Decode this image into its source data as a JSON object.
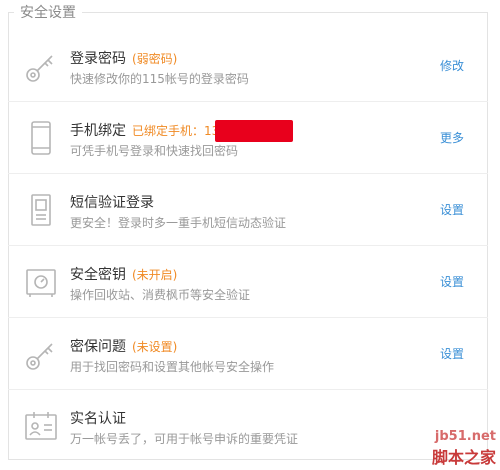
{
  "section_title": "安全设置",
  "items": [
    {
      "title": "登录密码",
      "status": "(弱密码)",
      "desc": "快速修改你的115帐号的登录密码",
      "action": "修改",
      "icon": "key-icon"
    },
    {
      "title": "手机绑定",
      "status": "已绑定手机：13",
      "desc": "可凭手机号登录和快速找回密码",
      "action": "更多",
      "icon": "phone-icon",
      "redacted": true
    },
    {
      "title": "短信验证登录",
      "status": "",
      "desc": "更安全！登录时多一重手机短信动态验证",
      "action": "设置",
      "icon": "sms-device-icon"
    },
    {
      "title": "安全密钥",
      "status": "(未开启)",
      "desc": "操作回收站、消费枫币等安全验证",
      "action": "设置",
      "icon": "safe-icon"
    },
    {
      "title": "密保问题",
      "status": "(未设置)",
      "desc": "用于找回密码和设置其他帐号安全操作",
      "action": "设置",
      "icon": "key-icon"
    },
    {
      "title": "实名认证",
      "status": "",
      "desc": "万一帐号丢了，可用于帐号申诉的重要凭证",
      "action": "",
      "icon": "id-card-icon"
    }
  ],
  "watermark": {
    "url": "jb51.net",
    "name": "脚本之家"
  },
  "colors": {
    "status": "#f08a24",
    "action": "#3a8fd6",
    "redaction": "#e8001c"
  }
}
